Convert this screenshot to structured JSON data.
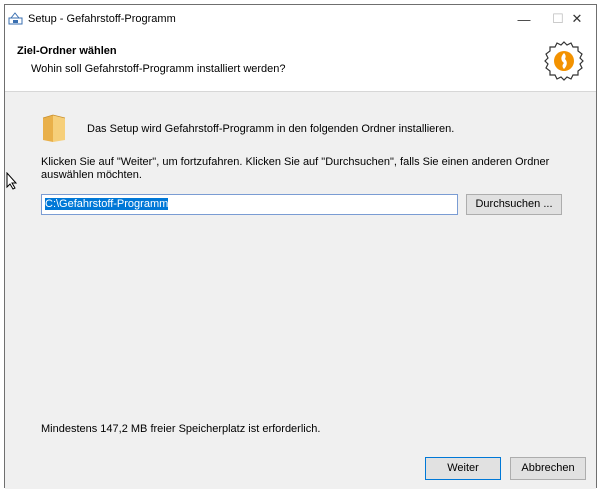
{
  "window": {
    "title": "Setup - Gefahrstoff-Programm",
    "minimize": "—",
    "maximize": "☐",
    "close": "✕"
  },
  "header": {
    "title": "Ziel-Ordner wählen",
    "subtitle": "Wohin soll Gefahrstoff-Programm installiert werden?"
  },
  "content": {
    "folder_text": "Das Setup wird Gefahrstoff-Programm in den folgenden Ordner installieren.",
    "instruction": "Klicken Sie auf \"Weiter\", um fortzufahren. Klicken Sie auf \"Durchsuchen\", falls Sie einen anderen Ordner auswählen möchten.",
    "path_value": "C:\\Gefahrstoff-Programm",
    "browse_label": "Durchsuchen ...",
    "space_required": "Mindestens 147,2 MB freier Speicherplatz ist erforderlich."
  },
  "footer": {
    "next_label": "Weiter",
    "cancel_label": "Abbrechen"
  },
  "colors": {
    "selection": "#0078d7",
    "panel": "#f0f0f0",
    "logo_orange": "#f39200"
  },
  "icons": [
    "setup-app-icon",
    "folder-icon",
    "program-logo-icon",
    "mouse-cursor-icon"
  ]
}
